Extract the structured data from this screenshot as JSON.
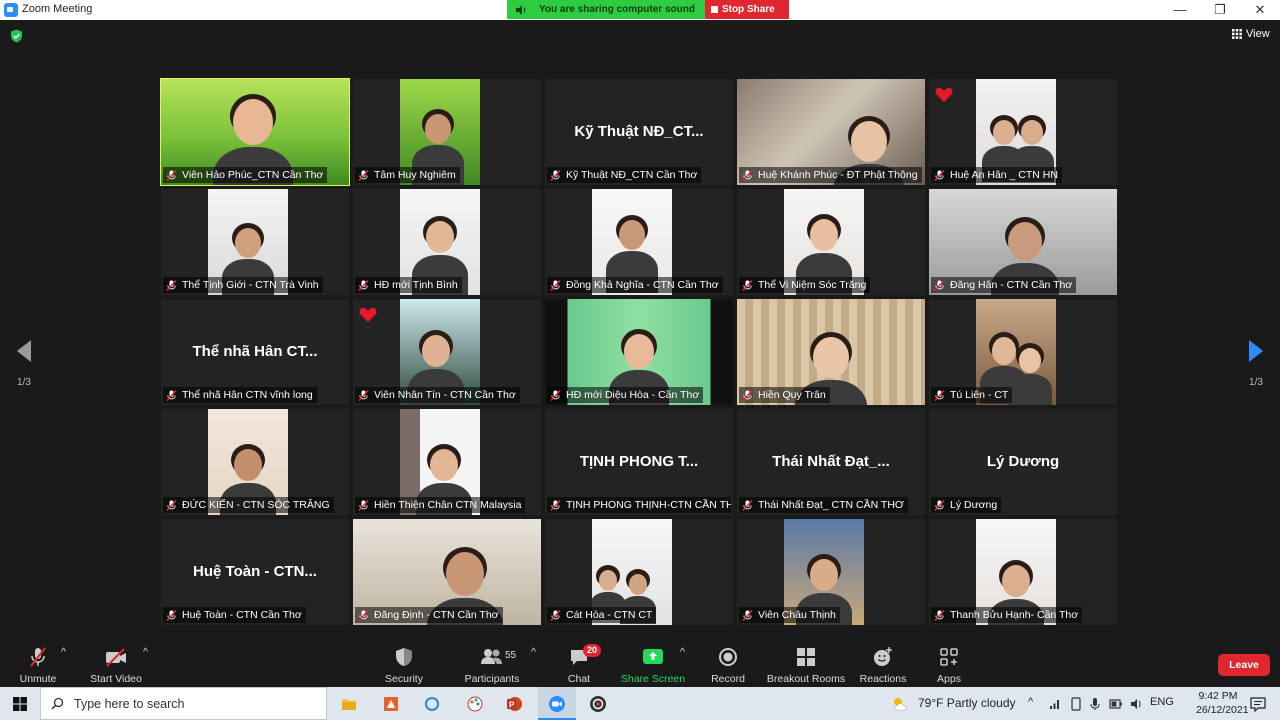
{
  "window": {
    "title": "Zoom Meeting",
    "minimize": "—",
    "maximize": "❐",
    "close": "✕"
  },
  "share_banner": {
    "sound_text": "You are sharing computer sound",
    "stop_text": "Stop Share"
  },
  "view_button": {
    "label": "View"
  },
  "pager": {
    "left_text": "1/3",
    "right_text": "1/3"
  },
  "participants": [
    {
      "name": "Viên Hảo Phúc_CTN Cần Thơ",
      "display": "video",
      "active": true
    },
    {
      "name": "Tâm Huy Nghiêm",
      "display": "video"
    },
    {
      "name": "Kỹ Thuật NĐ_CTN Cần Thơ",
      "display": "name",
      "big_name": "Kỹ Thuật NĐ_CT..."
    },
    {
      "name": "Huệ Khánh Phúc - ĐT Phật Thông",
      "display": "video"
    },
    {
      "name": "Huệ An Hân _ CTN HN",
      "display": "video",
      "reaction": "heart"
    },
    {
      "name": "Thể Tịnh Giới - CTN Trà Vinh",
      "display": "video"
    },
    {
      "name": "HĐ mới Tịnh Bình",
      "display": "video"
    },
    {
      "name": "Đồng Khả Nghĩa - CTN Cần Thơ",
      "display": "video"
    },
    {
      "name": "Thể Vi Niệm Sóc Trăng",
      "display": "video"
    },
    {
      "name": "Đăng Hân - CTN Cần Thơ",
      "display": "video"
    },
    {
      "name": "Thể nhã Hân CTN vĩnh long",
      "display": "name",
      "big_name": "Thể nhã Hân CT..."
    },
    {
      "name": "Viên Nhân Tín - CTN Cần Thơ",
      "display": "video",
      "reaction": "heart"
    },
    {
      "name": "HĐ mới Diệu Hòa - Cần Thơ",
      "display": "video"
    },
    {
      "name": "Hiền Quy Trân",
      "display": "video"
    },
    {
      "name": "Tú Liên - CT",
      "display": "video"
    },
    {
      "name": "ĐỨC KIẾN - CTN SÓC TRĂNG",
      "display": "video"
    },
    {
      "name": "Hiền Thiện Chân CTN Malaysia",
      "display": "video"
    },
    {
      "name": "TỊNH PHONG THỊNH-CTN CẦN TH...",
      "display": "name",
      "big_name": "TỊNH PHONG T..."
    },
    {
      "name": "Thái Nhất Đạt_ CTN CẦN THƠ",
      "display": "name",
      "big_name": "Thái Nhất Đạt_..."
    },
    {
      "name": "Lý Dương",
      "display": "name",
      "big_name": "Lý Dương"
    },
    {
      "name": "Huệ Toàn - CTN Cần Thơ",
      "display": "name",
      "big_name": "Huệ Toàn - CTN..."
    },
    {
      "name": "Đăng Định - CTN Cần Thơ",
      "display": "video"
    },
    {
      "name": "Cát Hòa - CTN CT",
      "display": "video"
    },
    {
      "name": "Viên Châu Thịnh",
      "display": "video"
    },
    {
      "name": "Thanh Bửu Hạnh- Cần Thơ",
      "display": "video"
    }
  ],
  "toolbar": {
    "unmute": "Unmute",
    "start_video": "Start Video",
    "security": "Security",
    "participants": "Participants",
    "participants_count": "55",
    "chat": "Chat",
    "chat_badge": "20",
    "share_screen": "Share Screen",
    "record": "Record",
    "breakout_rooms": "Breakout Rooms",
    "reactions": "Reactions",
    "apps": "Apps",
    "leave": "Leave"
  },
  "taskbar": {
    "search_placeholder": "Type here to search",
    "weather": "79°F  Partly cloudy",
    "language": "ENG",
    "time": "9:42 PM",
    "date": "26/12/2021"
  },
  "colors": {
    "active_speaker_border": "#e8f35a",
    "banner_green": "#2ecc40",
    "banner_red": "#e0262e",
    "share_screen_green": "#23d959",
    "leave_red": "#e0262e"
  }
}
